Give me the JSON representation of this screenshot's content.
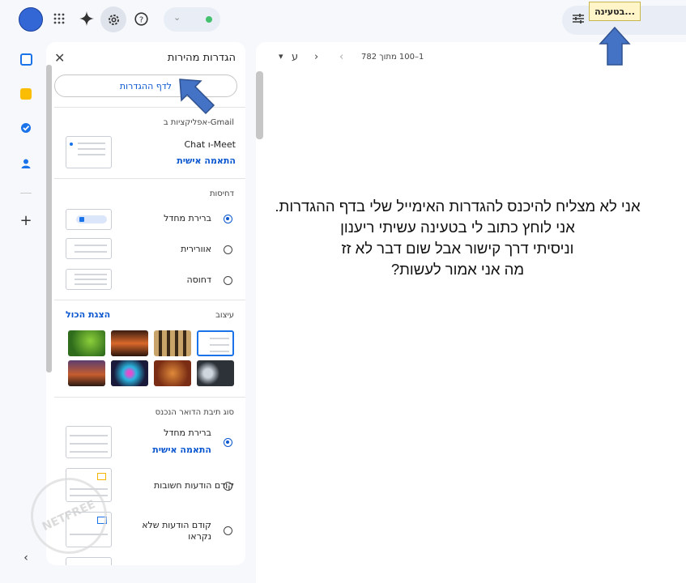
{
  "topbar": {
    "tooltip": "בטעינה..."
  },
  "settings_panel": {
    "title": "הגדרות מהירות",
    "all_settings_button": "לדף ההגדרות",
    "apps_section": {
      "heading": "אפליקציות ב-Gmail",
      "item": "Chat ו-Meet",
      "customize": "התאמה אישית"
    },
    "density_section": {
      "heading": "דחיסות",
      "options": [
        "ברירת מחדל",
        "אוורירית",
        "דחוסה"
      ],
      "selected": "ברירת מחדל"
    },
    "theme_section": {
      "heading": "עיצוב",
      "view_all": "הצגת הכול"
    },
    "inbox_section": {
      "heading": "סוג תיבת הדואר הנכנס",
      "options": [
        "ברירת מחדל",
        "קודם הודעות חשובות",
        "קודם הודעות שלא נקראו"
      ],
      "customize": "התאמה אישית",
      "selected": "ברירת מחדל"
    }
  },
  "mail_toolbar": {
    "pagination": "1–100 מתוך 782",
    "lang_label": "ע"
  },
  "overlay_question": [
    "אני לא מצליח להיכנס להגדרות האימייל שלי בדף ההגדרות.",
    "אני לוחץ כתוב לי בטעינה עשיתי ריענון",
    "וניסיתי דרך קישור אבל שום דבר לא זז",
    "מה אני אמור לעשות?"
  ],
  "watermark": "NETFREE",
  "colors": {
    "accent": "#0b57d0",
    "annotation_arrow": "#4472c4",
    "tooltip_bg": "#fff5c9"
  },
  "icons": {
    "apps": "grid-icon",
    "gemini": "sparkle-icon",
    "settings": "gear-icon",
    "help": "help-icon",
    "tune": "tune-icon"
  }
}
